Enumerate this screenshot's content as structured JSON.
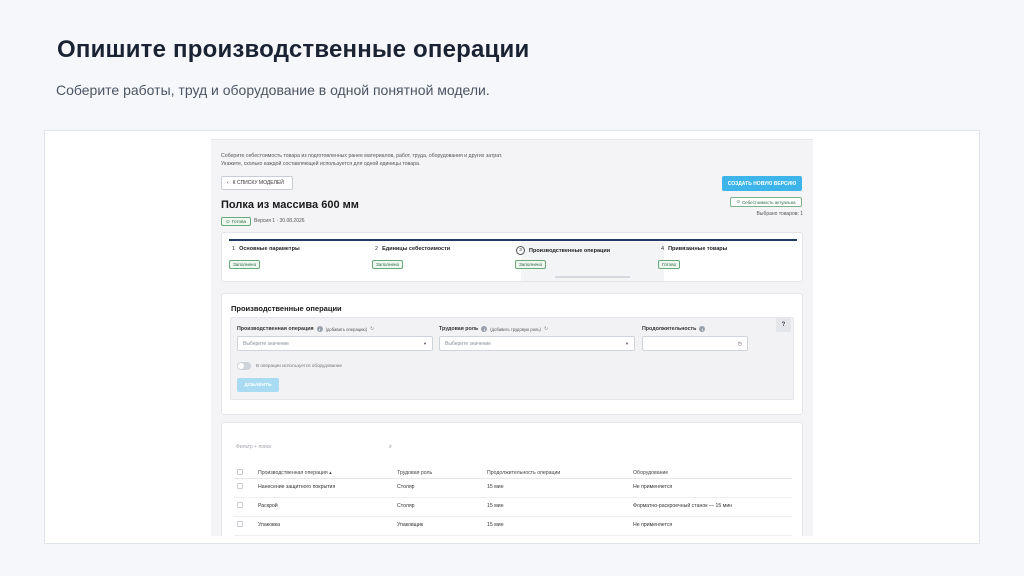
{
  "slide": {
    "title": "Опишите производственные операции",
    "subtitle": "Соберите работы, труд и оборудование в одной понятной модели."
  },
  "app": {
    "intro_line1": "Соберите себестоимость товара из подготовленных ранее материалов, работ, труда, оборудования и других затрат.",
    "intro_line2": "Укажите, сколько каждой составляющей используется для одной единицы товара.",
    "back_label": "К СПИСКУ МОДЕЛЕЙ",
    "create_version_label": "СОЗДАТЬ НОВУЮ ВЕРСИЮ",
    "cost_status": "Себестоимость актуальна",
    "selected_count": "Выбрано товаров: 1",
    "model_title": "Полка из массива 600 мм",
    "status": "Готова",
    "version_info": "Версия 1 · 30.08.2026",
    "accent_color": "#3db5ea"
  },
  "steps": [
    {
      "num": "1",
      "label": "Основные параметры",
      "status": "Заполнено"
    },
    {
      "num": "2",
      "label": "Единицы себестоимости",
      "status": "Заполнено"
    },
    {
      "num": "3",
      "label": "Производственные операции",
      "status": "Заполнено"
    },
    {
      "num": "4",
      "label": "Привязанные товары",
      "status": "Готово"
    }
  ],
  "ops": {
    "title": "Производственные операции",
    "operation_label": "Производственная операция",
    "operation_link": "(добавить операцию)",
    "role_label": "Трудовая роль",
    "role_link": "(добавить трудовую роль)",
    "duration_label": "Продолжительность",
    "select_placeholder": "Выберите значение",
    "help": "?",
    "equipment_toggle": "В операции используется оборудование",
    "add_label": "ДОБАВИТЬ"
  },
  "table": {
    "filter_placeholder": "Фильтр + поиск",
    "headers": [
      "Производственная операция",
      "Трудовая роль",
      "Продолжительность операции",
      "Оборудование"
    ],
    "rows": [
      [
        "Нанесение защитного покрытия",
        "Столяр",
        "15 мин",
        "Не применяется"
      ],
      [
        "Раскрой",
        "Столяр",
        "15 мин",
        "Форматно-раскроечный станок — 15 мин"
      ],
      [
        "Упаковка",
        "Упаковщик",
        "15 мин",
        "Не применяется"
      ]
    ]
  }
}
